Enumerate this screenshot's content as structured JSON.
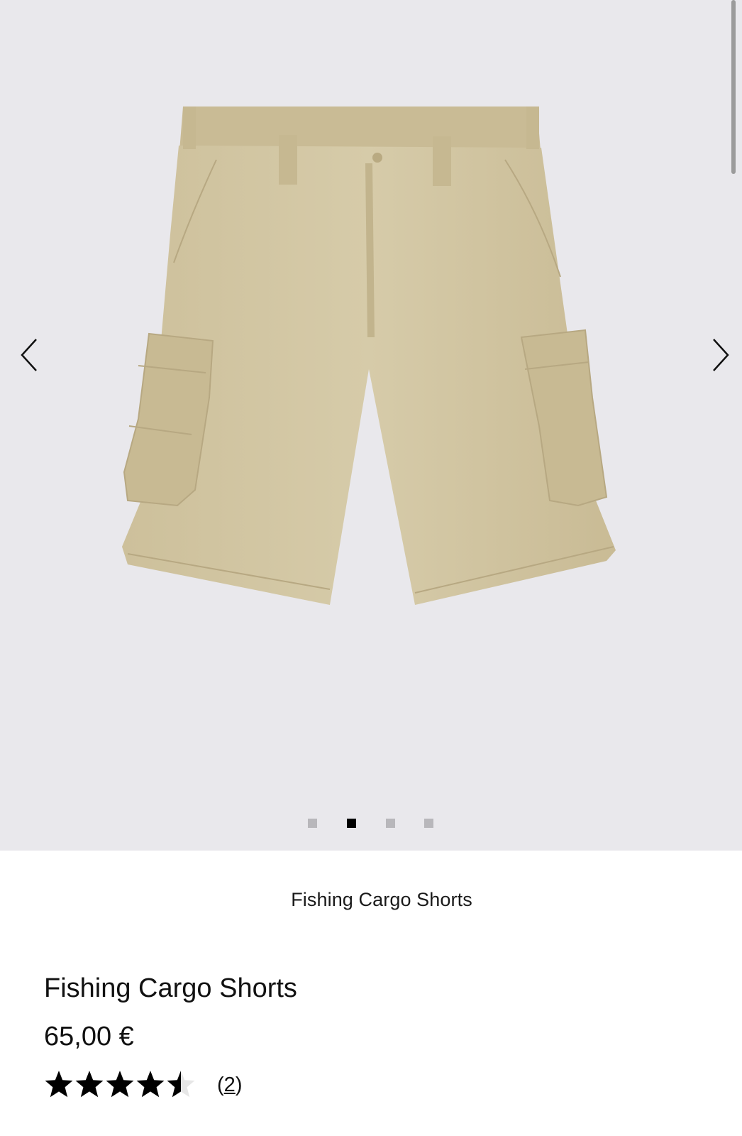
{
  "gallery": {
    "image_alt": "Fishing Cargo Shorts",
    "dots": [
      {
        "active": false
      },
      {
        "active": true
      },
      {
        "active": false
      },
      {
        "active": false
      }
    ],
    "prev_icon": "chevron-left-icon",
    "next_icon": "chevron-right-icon"
  },
  "product": {
    "caption": "Fishing Cargo Shorts",
    "name": "Fishing Cargo Shorts",
    "price": "65,00 €",
    "rating": 4.5,
    "rating_max": 5,
    "review_count_open": "(",
    "review_count": "2",
    "review_count_close": ")"
  },
  "colors": {
    "gallery_bg": "#e9e8ec",
    "shorts": "#d2c6a2",
    "dot_active": "#000000",
    "dot_inactive": "#b8b7bb"
  }
}
